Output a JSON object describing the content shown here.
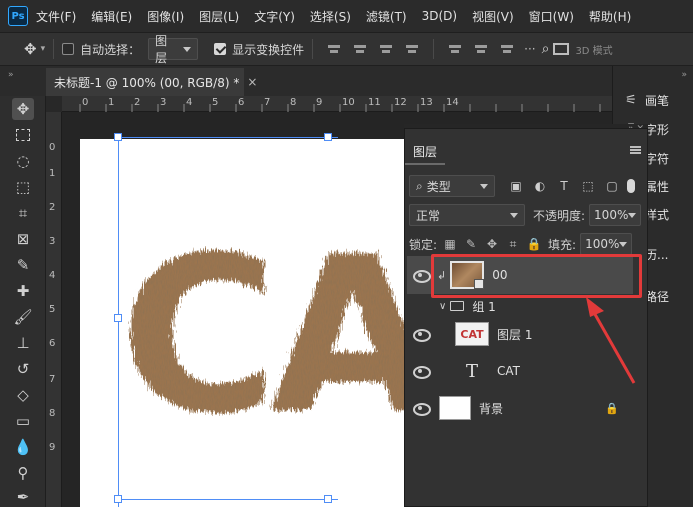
{
  "app": {
    "logo": "Ps",
    "menu": [
      "文件(F)",
      "编辑(E)",
      "图像(I)",
      "图层(L)",
      "文字(Y)",
      "选择(S)",
      "滤镜(T)",
      "3D(D)",
      "视图(V)",
      "窗口(W)",
      "帮助(H)"
    ]
  },
  "options": {
    "auto_select_label": "自动选择：",
    "auto_select_target": "图层",
    "show_transform_label": "显示变换控件",
    "mode_3d": "3D 模式"
  },
  "document": {
    "tab_title": "未标题-1 @ 100% (00, RGB/8) *",
    "close_glyph": "×",
    "canvas_text": "CAT",
    "ruler_top": [
      "0",
      "1",
      "2",
      "3",
      "4",
      "5",
      "6",
      "7",
      "8",
      "9",
      "10",
      "11",
      "12",
      "13",
      "14"
    ],
    "ruler_left": [
      "0",
      "1",
      "2",
      "3",
      "4",
      "5",
      "6",
      "7",
      "8",
      "9"
    ]
  },
  "right_dock": [
    {
      "icon": "brush-settings-icon",
      "label": "画笔"
    },
    {
      "icon": "character-icon",
      "label": "字形"
    },
    {
      "icon": "character-icon",
      "label": "字符"
    },
    {
      "icon": "properties-icon",
      "label": "属性"
    },
    {
      "icon": "styles-icon",
      "label": "样式"
    },
    {
      "icon": "history-icon",
      "label": "历..."
    },
    {
      "icon": "paths-icon",
      "label": "路径"
    }
  ],
  "layers_panel": {
    "title": "图层",
    "filter_kind": "类型",
    "blend_mode": "正常",
    "opacity_label": "不透明度:",
    "opacity_value": "100%",
    "lock_label": "锁定:",
    "fill_label": "填充:",
    "fill_value": "100%",
    "layers": [
      {
        "name": "00",
        "type": "smart-object",
        "selected": true
      },
      {
        "name": "组 1",
        "type": "group"
      },
      {
        "name": "图层 1",
        "type": "pixel",
        "thumb_text": "CAT"
      },
      {
        "name": "CAT",
        "type": "text",
        "glyph": "T"
      },
      {
        "name": "背景",
        "type": "background",
        "locked": true
      }
    ]
  },
  "colors": {
    "accent_blue": "#4f8df6",
    "highlight_red": "#e23a3a",
    "panel_bg": "#323232",
    "fur_brown": "#9b7550"
  }
}
